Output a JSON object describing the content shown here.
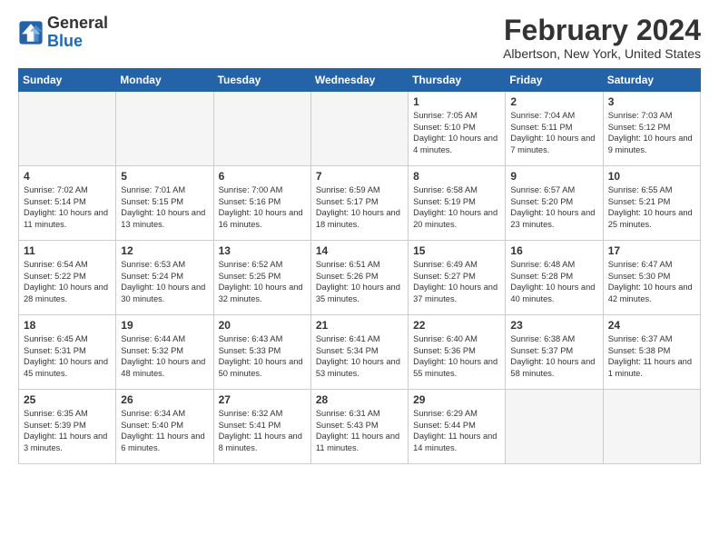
{
  "header": {
    "logo_line1": "General",
    "logo_line2": "Blue",
    "month": "February 2024",
    "location": "Albertson, New York, United States"
  },
  "weekdays": [
    "Sunday",
    "Monday",
    "Tuesday",
    "Wednesday",
    "Thursday",
    "Friday",
    "Saturday"
  ],
  "weeks": [
    [
      {
        "day": "",
        "info": ""
      },
      {
        "day": "",
        "info": ""
      },
      {
        "day": "",
        "info": ""
      },
      {
        "day": "",
        "info": ""
      },
      {
        "day": "1",
        "info": "Sunrise: 7:05 AM\nSunset: 5:10 PM\nDaylight: 10 hours\nand 4 minutes."
      },
      {
        "day": "2",
        "info": "Sunrise: 7:04 AM\nSunset: 5:11 PM\nDaylight: 10 hours\nand 7 minutes."
      },
      {
        "day": "3",
        "info": "Sunrise: 7:03 AM\nSunset: 5:12 PM\nDaylight: 10 hours\nand 9 minutes."
      }
    ],
    [
      {
        "day": "4",
        "info": "Sunrise: 7:02 AM\nSunset: 5:14 PM\nDaylight: 10 hours\nand 11 minutes."
      },
      {
        "day": "5",
        "info": "Sunrise: 7:01 AM\nSunset: 5:15 PM\nDaylight: 10 hours\nand 13 minutes."
      },
      {
        "day": "6",
        "info": "Sunrise: 7:00 AM\nSunset: 5:16 PM\nDaylight: 10 hours\nand 16 minutes."
      },
      {
        "day": "7",
        "info": "Sunrise: 6:59 AM\nSunset: 5:17 PM\nDaylight: 10 hours\nand 18 minutes."
      },
      {
        "day": "8",
        "info": "Sunrise: 6:58 AM\nSunset: 5:19 PM\nDaylight: 10 hours\nand 20 minutes."
      },
      {
        "day": "9",
        "info": "Sunrise: 6:57 AM\nSunset: 5:20 PM\nDaylight: 10 hours\nand 23 minutes."
      },
      {
        "day": "10",
        "info": "Sunrise: 6:55 AM\nSunset: 5:21 PM\nDaylight: 10 hours\nand 25 minutes."
      }
    ],
    [
      {
        "day": "11",
        "info": "Sunrise: 6:54 AM\nSunset: 5:22 PM\nDaylight: 10 hours\nand 28 minutes."
      },
      {
        "day": "12",
        "info": "Sunrise: 6:53 AM\nSunset: 5:24 PM\nDaylight: 10 hours\nand 30 minutes."
      },
      {
        "day": "13",
        "info": "Sunrise: 6:52 AM\nSunset: 5:25 PM\nDaylight: 10 hours\nand 32 minutes."
      },
      {
        "day": "14",
        "info": "Sunrise: 6:51 AM\nSunset: 5:26 PM\nDaylight: 10 hours\nand 35 minutes."
      },
      {
        "day": "15",
        "info": "Sunrise: 6:49 AM\nSunset: 5:27 PM\nDaylight: 10 hours\nand 37 minutes."
      },
      {
        "day": "16",
        "info": "Sunrise: 6:48 AM\nSunset: 5:28 PM\nDaylight: 10 hours\nand 40 minutes."
      },
      {
        "day": "17",
        "info": "Sunrise: 6:47 AM\nSunset: 5:30 PM\nDaylight: 10 hours\nand 42 minutes."
      }
    ],
    [
      {
        "day": "18",
        "info": "Sunrise: 6:45 AM\nSunset: 5:31 PM\nDaylight: 10 hours\nand 45 minutes."
      },
      {
        "day": "19",
        "info": "Sunrise: 6:44 AM\nSunset: 5:32 PM\nDaylight: 10 hours\nand 48 minutes."
      },
      {
        "day": "20",
        "info": "Sunrise: 6:43 AM\nSunset: 5:33 PM\nDaylight: 10 hours\nand 50 minutes."
      },
      {
        "day": "21",
        "info": "Sunrise: 6:41 AM\nSunset: 5:34 PM\nDaylight: 10 hours\nand 53 minutes."
      },
      {
        "day": "22",
        "info": "Sunrise: 6:40 AM\nSunset: 5:36 PM\nDaylight: 10 hours\nand 55 minutes."
      },
      {
        "day": "23",
        "info": "Sunrise: 6:38 AM\nSunset: 5:37 PM\nDaylight: 10 hours\nand 58 minutes."
      },
      {
        "day": "24",
        "info": "Sunrise: 6:37 AM\nSunset: 5:38 PM\nDaylight: 11 hours\nand 1 minute."
      }
    ],
    [
      {
        "day": "25",
        "info": "Sunrise: 6:35 AM\nSunset: 5:39 PM\nDaylight: 11 hours\nand 3 minutes."
      },
      {
        "day": "26",
        "info": "Sunrise: 6:34 AM\nSunset: 5:40 PM\nDaylight: 11 hours\nand 6 minutes."
      },
      {
        "day": "27",
        "info": "Sunrise: 6:32 AM\nSunset: 5:41 PM\nDaylight: 11 hours\nand 8 minutes."
      },
      {
        "day": "28",
        "info": "Sunrise: 6:31 AM\nSunset: 5:43 PM\nDaylight: 11 hours\nand 11 minutes."
      },
      {
        "day": "29",
        "info": "Sunrise: 6:29 AM\nSunset: 5:44 PM\nDaylight: 11 hours\nand 14 minutes."
      },
      {
        "day": "",
        "info": ""
      },
      {
        "day": "",
        "info": ""
      }
    ]
  ]
}
